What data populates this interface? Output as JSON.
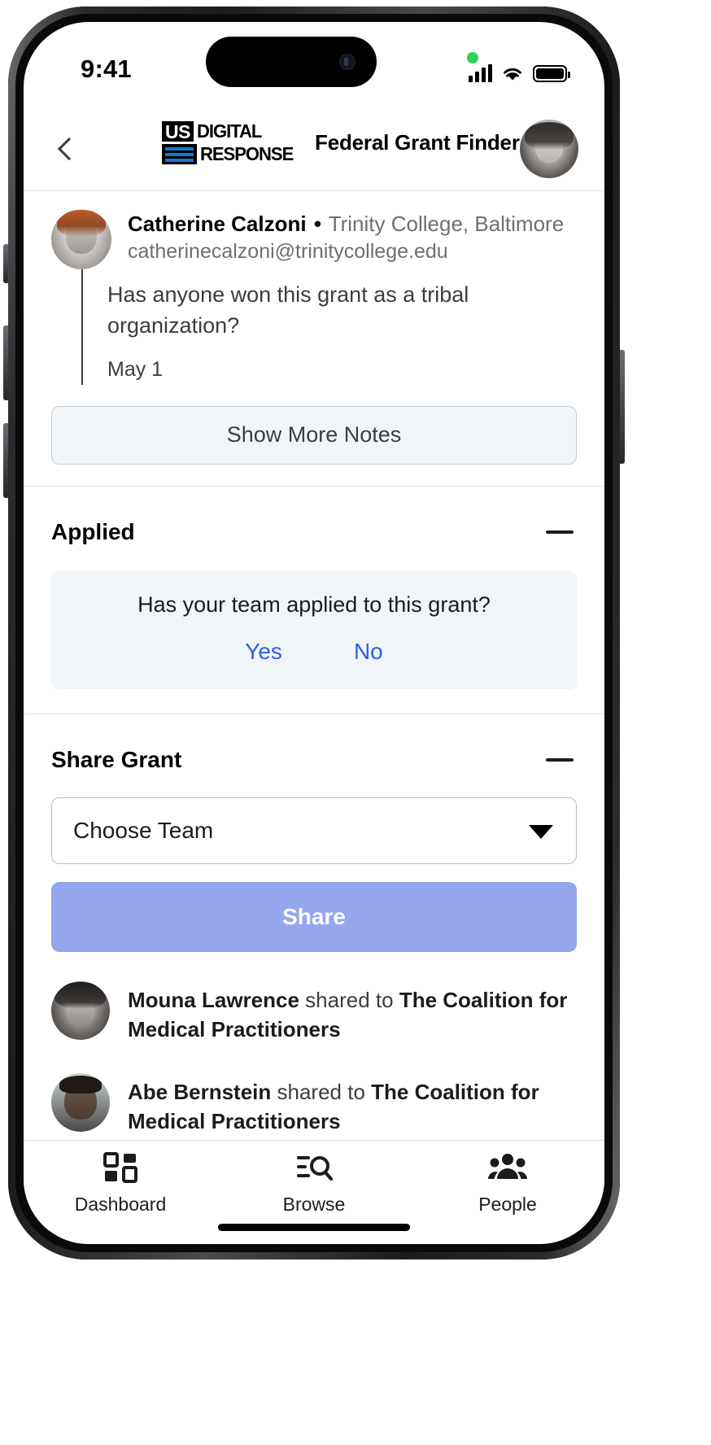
{
  "status_bar": {
    "time": "9:41",
    "icons": [
      "recording-dot",
      "cellular-signal-icon",
      "wifi-icon",
      "battery-icon"
    ]
  },
  "header": {
    "back_icon": "chevron-left-icon",
    "logo": {
      "badge_text": "US",
      "line1": "DIGITAL",
      "line2": "RESPONSE",
      "accent_color": "#1476d2"
    },
    "app_title": "Federal Grant Finder",
    "avatar_name": "user-avatar"
  },
  "note": {
    "author": "Catherine Calzoni",
    "separator": "•",
    "organization": "Trinity College, Baltimore",
    "email": "catherinecalzoni@trinitycollege.edu",
    "text": "Has anyone won this grant as a tribal organization?",
    "date": "May 1",
    "show_more_label": "Show More Notes"
  },
  "applied_section": {
    "title": "Applied",
    "collapse_icon": "minus-icon",
    "question": "Has your team applied to this grant?",
    "yes_label": "Yes",
    "no_label": "No",
    "link_color": "#2f5fe0"
  },
  "share_section": {
    "title": "Share Grant",
    "collapse_icon": "minus-icon",
    "team_select_value": "Choose Team",
    "dropdown_icon": "chevron-down-icon",
    "share_button_label": "Share",
    "share_button_color": "#94a6ec",
    "shares": [
      {
        "person": "Mouna Lawrence",
        "action": "shared to",
        "team": "The Coalition for Medical Practitioners"
      },
      {
        "person": "Abe Bernstein",
        "action": "shared to",
        "team": "The Coalition for Medical Practitioners"
      }
    ]
  },
  "tab_bar": {
    "tabs": [
      {
        "label": "Dashboard",
        "icon": "grid-dashboard-icon"
      },
      {
        "label": "Browse",
        "icon": "list-search-icon"
      },
      {
        "label": "People",
        "icon": "people-group-icon"
      }
    ]
  }
}
